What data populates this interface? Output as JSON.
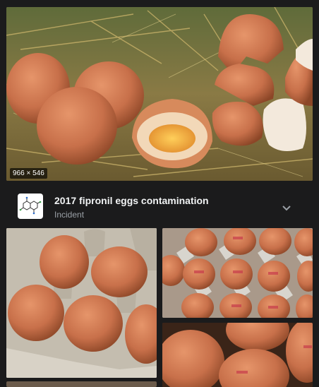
{
  "hero": {
    "dimensions": "966 × 546",
    "alt": "Brown eggs in straw nest"
  },
  "result": {
    "title": "2017 fipronil eggs contamination",
    "category": "Incident",
    "thumb_icon": "chemical-structure-icon",
    "expand_icon": "chevron-down-icon"
  },
  "colors": {
    "background": "#1b1b1c",
    "egg": "#c8704a",
    "straw": "#b9a15a"
  }
}
